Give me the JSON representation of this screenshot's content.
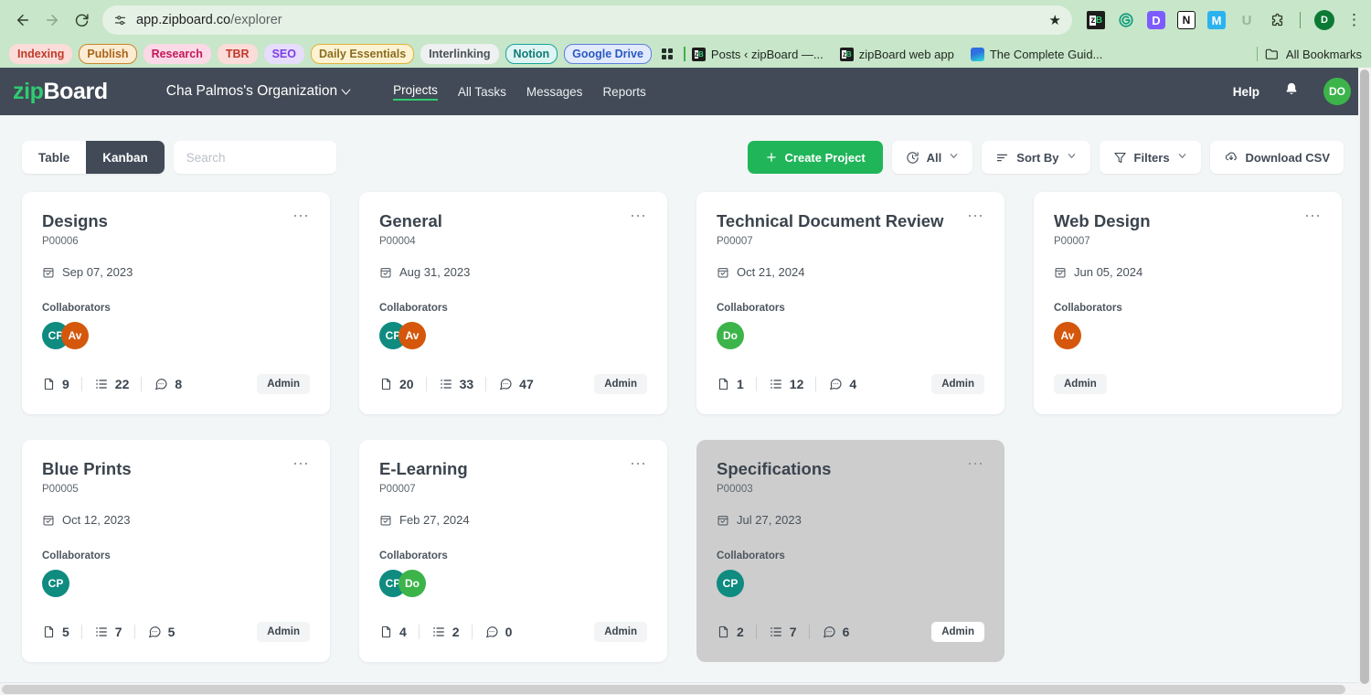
{
  "browser": {
    "url_host": "app.zipboard.co",
    "url_path": "/explorer",
    "back_icon": "back-arrow-icon",
    "forward_icon": "forward-arrow-icon",
    "reload_icon": "reload-icon",
    "site_info_icon": "site-settings-icon",
    "star_icon": "bookmark-star-icon",
    "profile_initial": "D",
    "menu_icon": "chrome-menu-icon",
    "extensions": [
      "zipboard-extension-icon",
      "grammarly-icon",
      "dualite-icon",
      "notion-web-clipper-icon",
      "mailtrack-icon",
      "u-extension-icon",
      "extensions-puzzle-icon"
    ],
    "bookmarks": [
      {
        "label": "Indexing",
        "bg": "#fbdcd8",
        "fg": "#c0392b",
        "border": "transparent"
      },
      {
        "label": "Publish",
        "bg": "#fdecd2",
        "fg": "#a9631b",
        "border": "#c8862c"
      },
      {
        "label": "Research",
        "bg": "#fbd9e6",
        "fg": "#c2185b",
        "border": "transparent"
      },
      {
        "label": "TBR",
        "bg": "#fbdcd8",
        "fg": "#c0392b",
        "border": "transparent"
      },
      {
        "label": "SEO",
        "bg": "#e6dcfb",
        "fg": "#7b3fe4",
        "border": "transparent"
      },
      {
        "label": "Daily Essentials",
        "bg": "#fdf3d2",
        "fg": "#8a6d1f",
        "border": "#e0b33a"
      },
      {
        "label": "Interlinking",
        "bg": "#eef0f1",
        "fg": "#4a5258",
        "border": "transparent"
      },
      {
        "label": "Notion",
        "bg": "#dff5f3",
        "fg": "#0f7a77",
        "border": "#17a39b"
      },
      {
        "label": "Google Drive",
        "bg": "#e2eafd",
        "fg": "#2b59c3",
        "border": "#5a7fe0"
      }
    ],
    "apps_icon": "apps-grid-icon",
    "site_bookmarks": [
      {
        "label": "Posts ‹ zipBoard —...",
        "favicon": "zipboard-favicon"
      },
      {
        "label": "zipBoard web app",
        "favicon": "zipboard-favicon"
      },
      {
        "label": "The Complete Guid...",
        "favicon": "blue-doc-favicon"
      }
    ],
    "all_bookmarks_label": "All Bookmarks",
    "folder_icon": "folder-icon"
  },
  "appbar": {
    "logo_zip": "zip",
    "logo_board": "Board",
    "org_name": "Cha Palmos's Organization",
    "org_chevron_icon": "chevron-down-icon",
    "nav": [
      {
        "label": "Projects",
        "active": true
      },
      {
        "label": "All Tasks",
        "active": false
      },
      {
        "label": "Messages",
        "active": false
      },
      {
        "label": "Reports",
        "active": false
      }
    ],
    "help_label": "Help",
    "bell_icon": "notification-bell-icon",
    "user_initials": "DO",
    "user_avatar_color": "#3cb44a"
  },
  "toolbar": {
    "view_table_label": "Table",
    "view_kanban_label": "Kanban",
    "active_view": "Kanban",
    "search_placeholder": "Search",
    "search_value": "",
    "create_project_label": "Create Project",
    "create_plus_icon": "plus-icon",
    "filter_all_label": "All",
    "filter_all_icon": "clock-icon",
    "sort_by_label": "Sort By",
    "sort_icon": "sort-lines-icon",
    "filters_label": "Filters",
    "filters_icon": "funnel-icon",
    "download_csv_label": "Download CSV",
    "download_icon": "cloud-download-icon",
    "chevron_icon": "chevron-down-icon",
    "accent_green": "#21b55a",
    "dark": "#414a56"
  },
  "board": {
    "collaborators_label": "Collaborators",
    "more_icon": "more-options-icon",
    "calendar_icon": "calendar-check-icon",
    "file_icon": "file-icon",
    "task_icon": "task-list-icon",
    "comment_icon": "comment-icon",
    "cards": [
      {
        "title": "Designs",
        "code": "P00006",
        "date": "Sep 07, 2023",
        "avatars": [
          {
            "initials": "CP",
            "color": "#0f8b80"
          },
          {
            "initials": "Av",
            "color": "#d4570c"
          }
        ],
        "files": "9",
        "tasks": "22",
        "comments": "8",
        "role": "Admin",
        "selected": false,
        "has_stats": true
      },
      {
        "title": "General",
        "code": "P00004",
        "date": "Aug 31, 2023",
        "avatars": [
          {
            "initials": "CP",
            "color": "#0f8b80"
          },
          {
            "initials": "Av",
            "color": "#d4570c"
          }
        ],
        "files": "20",
        "tasks": "33",
        "comments": "47",
        "role": "Admin",
        "selected": false,
        "has_stats": true
      },
      {
        "title": "Technical Document Review",
        "code": "P00007",
        "date": "Oct 21, 2024",
        "avatars": [
          {
            "initials": "Do",
            "color": "#3cb44a"
          }
        ],
        "files": "1",
        "tasks": "12",
        "comments": "4",
        "role": "Admin",
        "selected": false,
        "has_stats": true
      },
      {
        "title": "Web Design",
        "code": "P00007",
        "date": "Jun 05, 2024",
        "avatars": [
          {
            "initials": "Av",
            "color": "#d4570c"
          }
        ],
        "files": "",
        "tasks": "",
        "comments": "",
        "role": "Admin",
        "selected": false,
        "has_stats": false
      },
      {
        "title": "Blue Prints",
        "code": "P00005",
        "date": "Oct 12, 2023",
        "avatars": [
          {
            "initials": "CP",
            "color": "#0f8b80"
          }
        ],
        "files": "5",
        "tasks": "7",
        "comments": "5",
        "role": "Admin",
        "selected": false,
        "has_stats": true
      },
      {
        "title": "E-Learning",
        "code": "P00007",
        "date": "Feb 27, 2024",
        "avatars": [
          {
            "initials": "CP",
            "color": "#0f8b80"
          },
          {
            "initials": "Do",
            "color": "#3cb44a"
          }
        ],
        "files": "4",
        "tasks": "2",
        "comments": "0",
        "role": "Admin",
        "selected": false,
        "has_stats": true
      },
      {
        "title": "Specifications",
        "code": "P00003",
        "date": "Jul 27, 2023",
        "avatars": [
          {
            "initials": "CP",
            "color": "#0f8b80"
          }
        ],
        "files": "2",
        "tasks": "7",
        "comments": "6",
        "role": "Admin",
        "selected": true,
        "has_stats": true
      }
    ]
  }
}
